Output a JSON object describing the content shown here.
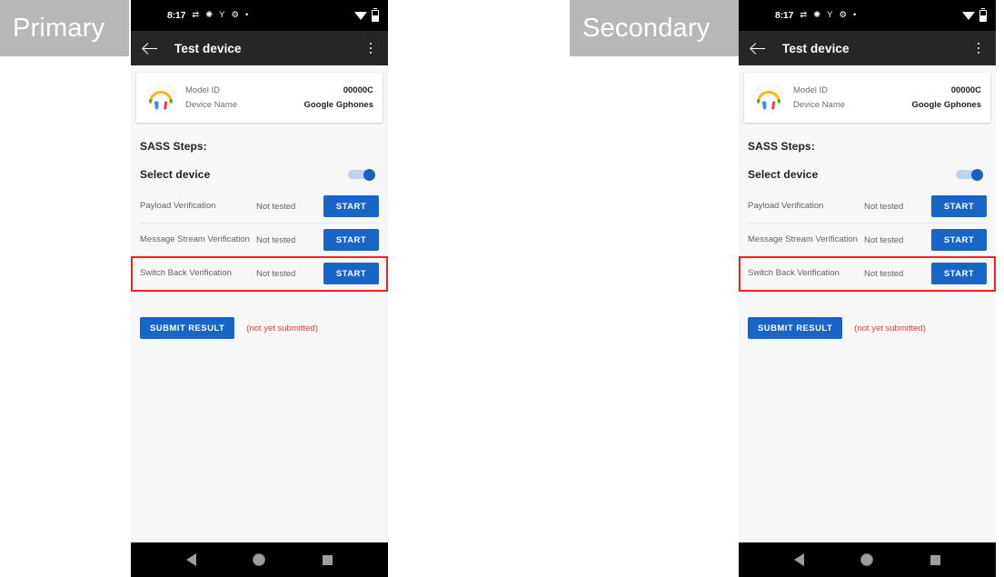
{
  "roles": [
    {
      "label": "Primary"
    },
    {
      "label": "Secondary"
    }
  ],
  "colors": {
    "accent_blue": "#1765c6",
    "toggle_track": "#bdd4ef",
    "toggle_thumb": "#1a5fc0",
    "highlight_red": "#fb2020",
    "note_red": "#ea3c3c",
    "app_bar": "#262626",
    "page_bg": "#f7f7f7",
    "chip_gray": "#b7b7b7"
  },
  "phone": {
    "status_bar": {
      "time": "8:17",
      "icons": [
        "sync-icon",
        "brightness-icon",
        "vpn-icon",
        "settings-gear-icon",
        "dot-icon"
      ],
      "right_icons": [
        "wifi-icon",
        "battery-icon"
      ]
    },
    "app_bar": {
      "back_icon": "back-arrow-icon",
      "title": "Test device",
      "overflow_icon": "overflow-menu-icon"
    },
    "device_card": {
      "logo_icon": "headphones-icon",
      "rows": [
        {
          "label": "Model ID",
          "value": "00000C"
        },
        {
          "label": "Device Name",
          "value": "Google Gphones"
        }
      ]
    },
    "section_title": "SASS Steps:",
    "select_device": {
      "label": "Select device",
      "toggle_state": "on"
    },
    "steps": [
      {
        "name": "Payload Verification",
        "status": "Not tested",
        "action": "START",
        "highlighted": false
      },
      {
        "name": "Message Stream Verification",
        "status": "Not tested",
        "action": "START",
        "highlighted": false
      },
      {
        "name": "Switch Back Verification",
        "status": "Not tested",
        "action": "START",
        "highlighted": true
      }
    ],
    "submit": {
      "button_label": "SUBMIT RESULT",
      "note": "(not yet submitted)"
    },
    "nav_bar": {
      "back": "nav-back-icon",
      "home": "nav-home-icon",
      "recents": "nav-recents-icon"
    }
  }
}
